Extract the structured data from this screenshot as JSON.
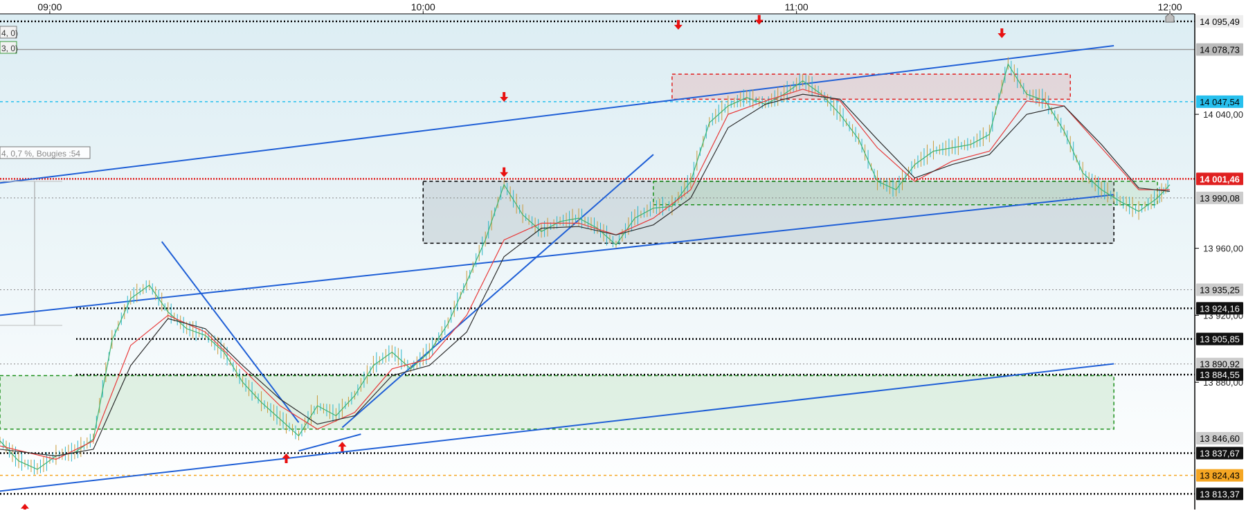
{
  "chart_data": {
    "type": "line",
    "title": "",
    "xlabel": "",
    "ylabel": "",
    "x_ticks": [
      "09:00",
      "10:00",
      "11:00",
      "12:00"
    ],
    "y_ticks": [
      "14 040,00",
      "13 960,00",
      "13 920,00",
      "13 880,00"
    ],
    "ylim": [
      13804,
      14100
    ],
    "xlim": [
      "08:52",
      "12:04"
    ],
    "grid": false,
    "price_series": {
      "name": "",
      "x": [
        "08:52",
        "08:55",
        "08:58",
        "09:01",
        "09:04",
        "09:07",
        "09:10",
        "09:13",
        "09:16",
        "09:19",
        "09:22",
        "09:25",
        "09:28",
        "09:31",
        "09:34",
        "09:37",
        "09:40",
        "09:43",
        "09:46",
        "09:49",
        "09:52",
        "09:55",
        "09:58",
        "10:01",
        "10:04",
        "10:07",
        "10:10",
        "10:13",
        "10:16",
        "10:19",
        "10:22",
        "10:25",
        "10:28",
        "10:31",
        "10:34",
        "10:37",
        "10:40",
        "10:43",
        "10:46",
        "10:49",
        "10:52",
        "10:55",
        "10:58",
        "11:01",
        "11:04",
        "11:07",
        "11:10",
        "11:13",
        "11:16",
        "11:19",
        "11:22",
        "11:25",
        "11:28",
        "11:31",
        "11:34",
        "11:37",
        "11:40",
        "11:43",
        "11:46",
        "11:49",
        "11:52",
        "11:55",
        "11:58",
        "12:00"
      ],
      "y": [
        13845,
        13833,
        13828,
        13836,
        13838,
        13846,
        13905,
        13930,
        13938,
        13922,
        13912,
        13908,
        13898,
        13880,
        13868,
        13858,
        13848,
        13866,
        13860,
        13872,
        13890,
        13898,
        13888,
        13898,
        13915,
        13940,
        13965,
        13998,
        13980,
        13970,
        13976,
        13978,
        13972,
        13962,
        13978,
        13984,
        13985,
        14000,
        14035,
        14045,
        14050,
        14046,
        14052,
        14060,
        14052,
        14040,
        14025,
        14000,
        13995,
        14010,
        14018,
        14020,
        14022,
        14028,
        14070,
        14052,
        14048,
        14030,
        14005,
        13995,
        13988,
        13982,
        13990,
        13998
      ]
    },
    "series": [
      {
        "name": "",
        "color": "#e83a3a",
        "x": [
          "08:52",
          "09:01",
          "09:07",
          "09:13",
          "09:19",
          "09:25",
          "09:31",
          "09:37",
          "09:43",
          "09:49",
          "09:55",
          "10:01",
          "10:07",
          "10:13",
          "10:19",
          "10:25",
          "10:31",
          "10:37",
          "10:43",
          "10:49",
          "10:55",
          "11:01",
          "11:07",
          "11:13",
          "11:19",
          "11:25",
          "11:31",
          "11:37",
          "11:43",
          "11:49",
          "11:55",
          "12:00"
        ],
        "y": [
          13842,
          13834,
          13845,
          13902,
          13920,
          13910,
          13888,
          13866,
          13852,
          13862,
          13888,
          13894,
          13920,
          13965,
          13975,
          13975,
          13968,
          13978,
          13995,
          14040,
          14048,
          14055,
          14048,
          14020,
          14000,
          14012,
          14018,
          14048,
          14045,
          14020,
          13995,
          13995
        ]
      },
      {
        "name": "",
        "color": "#2d2d2d",
        "x": [
          "08:52",
          "09:01",
          "09:07",
          "09:13",
          "09:19",
          "09:25",
          "09:31",
          "09:37",
          "09:43",
          "09:49",
          "09:55",
          "10:01",
          "10:07",
          "10:13",
          "10:19",
          "10:25",
          "10:31",
          "10:37",
          "10:43",
          "10:49",
          "10:55",
          "11:01",
          "11:07",
          "11:13",
          "11:19",
          "11:25",
          "11:31",
          "11:37",
          "11:43",
          "11:49",
          "11:55",
          "12:00"
        ],
        "y": [
          13840,
          13836,
          13840,
          13890,
          13918,
          13912,
          13890,
          13870,
          13855,
          13860,
          13884,
          13890,
          13910,
          13955,
          13972,
          13973,
          13968,
          13974,
          13990,
          14032,
          14046,
          14052,
          14049,
          14025,
          14002,
          14010,
          14016,
          14040,
          14045,
          14022,
          13996,
          13994
        ]
      }
    ],
    "price_tags": [
      {
        "label": "14 095,49",
        "y": 14095.49,
        "style": "dotted-black",
        "bg": "#eeeeee",
        "fg": "#000000"
      },
      {
        "label": "14 078,73",
        "y": 14078.73,
        "style": "solid-gray",
        "bg": "#bbbbbb",
        "fg": "#000000"
      },
      {
        "label": "14 047,54",
        "y": 14047.54,
        "style": "dashed-cyan",
        "bg": "#27c0ee",
        "fg": "#000000"
      },
      {
        "label": "14 001,46",
        "y": 14001.46,
        "style": "dotted-red",
        "bg": "#e02020",
        "fg": "#ffffff"
      },
      {
        "label": "13 990,08",
        "y": 13990.08,
        "style": "dotted-gray",
        "bg": "#cccccc",
        "fg": "#000000"
      },
      {
        "label": "13 935,25",
        "y": 13935.25,
        "style": "dotted-gray",
        "bg": "#cccccc",
        "fg": "#000000"
      },
      {
        "label": "13 924,16",
        "y": 13924.16,
        "style": "dotted-black",
        "bg": "#111111",
        "fg": "#ffffff"
      },
      {
        "label": "13 905,85",
        "y": 13905.85,
        "style": "dotted-black",
        "bg": "#111111",
        "fg": "#ffffff"
      },
      {
        "label": "13 890,92",
        "y": 13890.92,
        "style": "dotted-gray",
        "bg": "#cccccc",
        "fg": "#000000"
      },
      {
        "label": "13 884,55",
        "y": 13884.55,
        "style": "dotted-black",
        "bg": "#111111",
        "fg": "#ffffff"
      },
      {
        "label": "13 846,60",
        "y": 13846.6,
        "style": "none",
        "bg": "#cccccc",
        "fg": "#000000"
      },
      {
        "label": "13 837,67",
        "y": 13837.67,
        "style": "dotted-black",
        "bg": "#111111",
        "fg": "#ffffff"
      },
      {
        "label": "13 824,43",
        "y": 13824.43,
        "style": "dashed-orange",
        "bg": "#f5a623",
        "fg": "#000000"
      },
      {
        "label": "13 813,37",
        "y": 13813.37,
        "style": "dotted-black",
        "bg": "#111111",
        "fg": "#ffffff"
      }
    ],
    "trendlines": [
      {
        "from": [
          "08:52",
          13999
        ],
        "to": [
          "11:51",
          14081
        ]
      },
      {
        "from": [
          "08:52",
          13920
        ],
        "to": [
          "11:51",
          13992
        ]
      },
      {
        "from": [
          "08:52",
          13815
        ],
        "to": [
          "11:51",
          13891
        ]
      },
      {
        "from": [
          "09:18",
          13964
        ],
        "to": [
          "09:40",
          13856
        ]
      },
      {
        "from": [
          "09:40",
          13839
        ],
        "to": [
          "09:50",
          13849
        ]
      },
      {
        "from": [
          "09:47",
          13853
        ],
        "to": [
          "10:37",
          14016
        ]
      }
    ],
    "zones": [
      {
        "from": [
          "08:52",
          13884
        ],
        "to": [
          "11:51",
          13852
        ],
        "color": "green"
      },
      {
        "from": [
          "10:00",
          14000
        ],
        "to": [
          "11:51",
          13963
        ],
        "color": "gray"
      },
      {
        "from": [
          "10:37",
          14000
        ],
        "to": [
          "11:58",
          13986
        ],
        "color": "green"
      },
      {
        "from": [
          "10:40",
          14064
        ],
        "to": [
          "11:44",
          14049
        ],
        "color": "red"
      }
    ],
    "markers": [
      {
        "type": "down",
        "x": "10:41",
        "y": 14093
      },
      {
        "type": "down",
        "x": "10:54",
        "y": 14096
      },
      {
        "type": "down",
        "x": "11:33",
        "y": 14088
      },
      {
        "type": "down",
        "x": "10:13",
        "y": 14050
      },
      {
        "type": "down",
        "x": "10:13",
        "y": 14005
      },
      {
        "type": "up",
        "x": "09:38",
        "y": 13835
      },
      {
        "type": "up",
        "x": "09:47",
        "y": 13842
      },
      {
        "type": "up",
        "x": "08:56",
        "y": 13805
      }
    ],
    "annotations": [
      "4, 0)",
      "3, 0)",
      "4, 0,7 %, Bougies :54"
    ]
  }
}
